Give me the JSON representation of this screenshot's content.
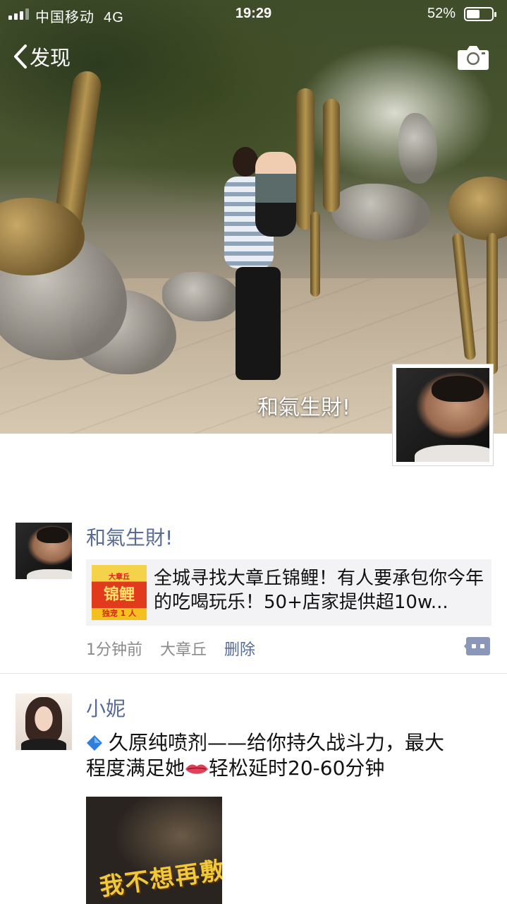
{
  "status_bar": {
    "carrier": "中国移动",
    "network": "4G",
    "time": "19:29",
    "battery_percent": "52%",
    "battery_level": 0.52
  },
  "nav": {
    "back_label": "发现",
    "icons": {
      "back": "chevron-left-icon",
      "camera": "camera-icon"
    }
  },
  "cover": {
    "user_name": "和氣生財!"
  },
  "posts": [
    {
      "author": "和氣生財!",
      "link": {
        "thumb_top": "大章丘",
        "thumb_title": "锦鲤",
        "thumb_bottom": "独宠 1 人",
        "text": "全城寻找大章丘锦鲤！有人要承包你今年的吃喝玩乐！50+店家提供超10w..."
      },
      "time": "1分钟前",
      "location": "大章丘",
      "delete_label": "删除"
    },
    {
      "author": "小妮",
      "text_line1": "久原纯喷剂——给你持久战斗力，最大",
      "text_line2_a": "程度满足她",
      "text_line2_b": "轻松延时20-60分钟",
      "image_text": "我不想再敷衍"
    }
  ],
  "colors": {
    "link_blue": "#576b95",
    "meta_gray": "#8a8a8a",
    "card_bg": "#f3f3f5"
  }
}
